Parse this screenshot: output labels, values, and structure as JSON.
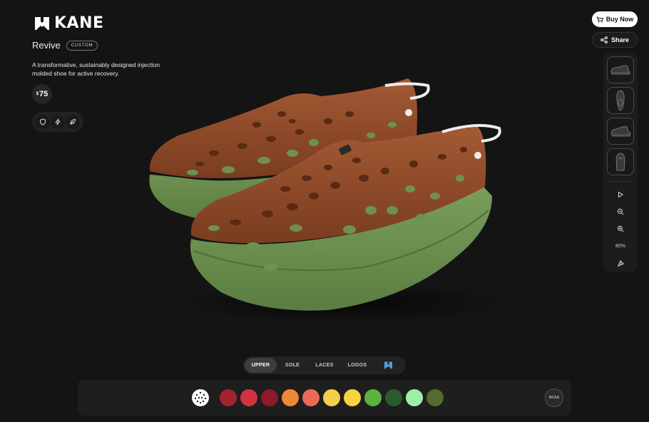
{
  "brand": {
    "name": "KANE"
  },
  "product": {
    "name": "Revive",
    "badge": "CUSTOM",
    "description": "A transformative, sustainably designed injection molded shoe for active recovery.",
    "price_symbol": "$",
    "price": "75"
  },
  "features": [
    {
      "icon": "shield-icon"
    },
    {
      "icon": "lightning-icon"
    },
    {
      "icon": "leaf-icon"
    }
  ],
  "actions": {
    "buy_label": "Buy Now",
    "share_label": "Share"
  },
  "view_panel": {
    "views": [
      "side-view",
      "top-view",
      "angled-view",
      "back-view"
    ],
    "tools": [
      "play-icon",
      "zoom-out-icon",
      "zoom-in-icon",
      "reset-view-icon"
    ],
    "zoom_level": "80%"
  },
  "tabs": [
    {
      "label": "UPPER",
      "active": true
    },
    {
      "label": "SOLE",
      "active": false
    },
    {
      "label": "LACES",
      "active": false
    },
    {
      "label": "LOGOS",
      "active": false
    }
  ],
  "colors": {
    "upper": "#8a4a2a",
    "sole": "#6e9150",
    "background": "#141414"
  },
  "swatches": [
    "#a2232f",
    "#d2323f",
    "#8c1a28",
    "#ee8a35",
    "#ec6a55",
    "#f4cf4a",
    "#f6d441",
    "#5bb240",
    "#2c5a2f",
    "#9cf0a6",
    "#566b2f"
  ]
}
